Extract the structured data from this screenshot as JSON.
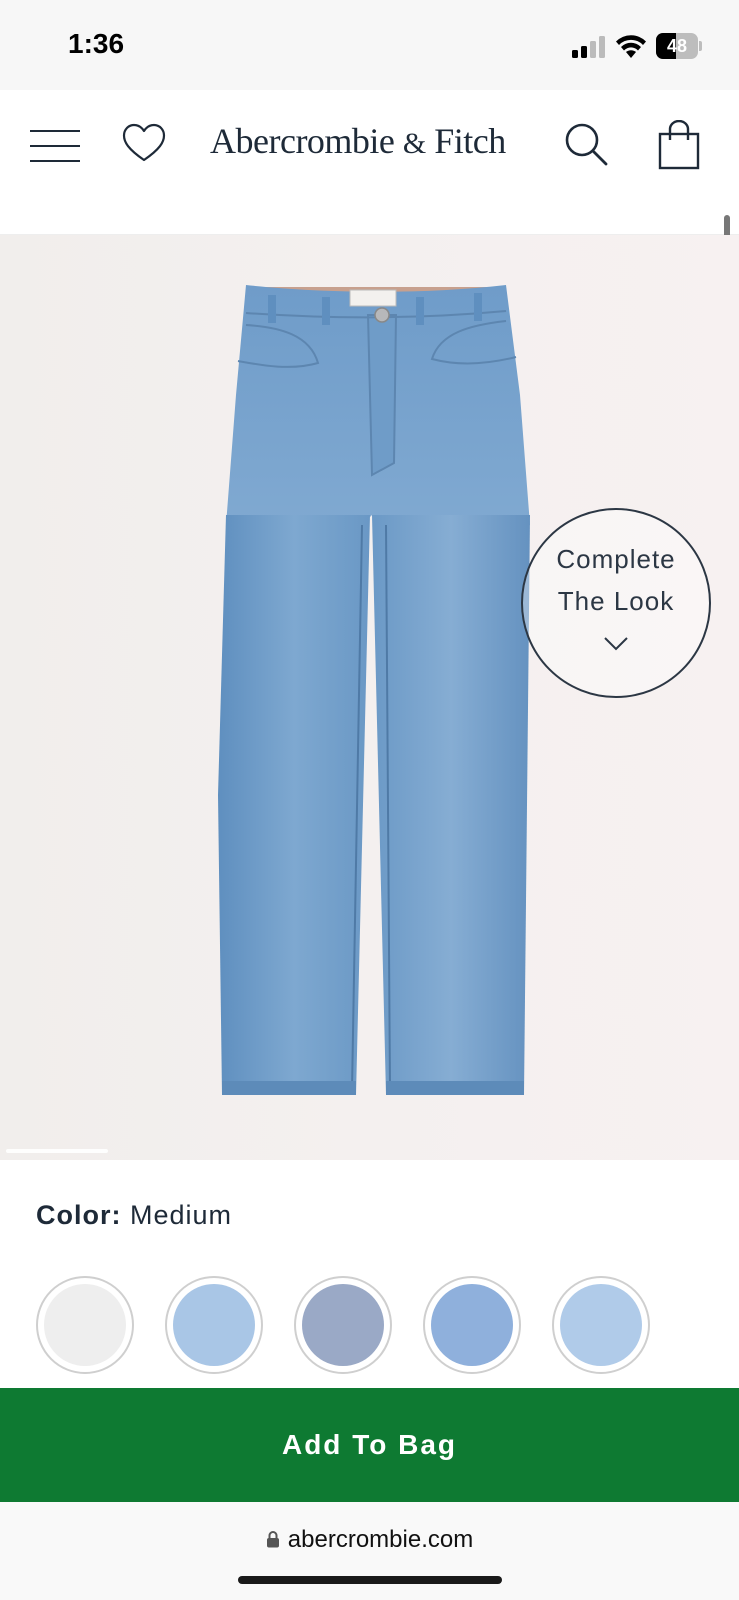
{
  "status_bar": {
    "time": "1:36",
    "battery_level": "48",
    "battery_percent": 48
  },
  "header": {
    "brand_name": "Abercrombie",
    "brand_amp": "&",
    "brand_name_2": "Fitch",
    "icons": [
      "menu-icon",
      "heart-icon",
      "search-icon",
      "shopping-bag-icon"
    ]
  },
  "product": {
    "complete_look_line1": "Complete",
    "complete_look_line2": "The Look",
    "color_label": "Color:",
    "color_value": "Medium",
    "swatches": [
      {
        "name": "white",
        "color": "#eeeeee"
      },
      {
        "name": "light-blue",
        "color": "#a9c6e6"
      },
      {
        "name": "medium-gray-blue",
        "color": "#9aa9c6"
      },
      {
        "name": "medium-blue",
        "color": "#8fb0dc"
      },
      {
        "name": "pale-blue",
        "color": "#b0cbe9"
      }
    ]
  },
  "actions": {
    "add_to_bag_label": "Add To Bag"
  },
  "browser": {
    "url": "abercrombie.com"
  },
  "colors": {
    "accent_green": "#0e7a32",
    "navy_text": "#1e2a38",
    "denim": "#6d9bc7"
  }
}
